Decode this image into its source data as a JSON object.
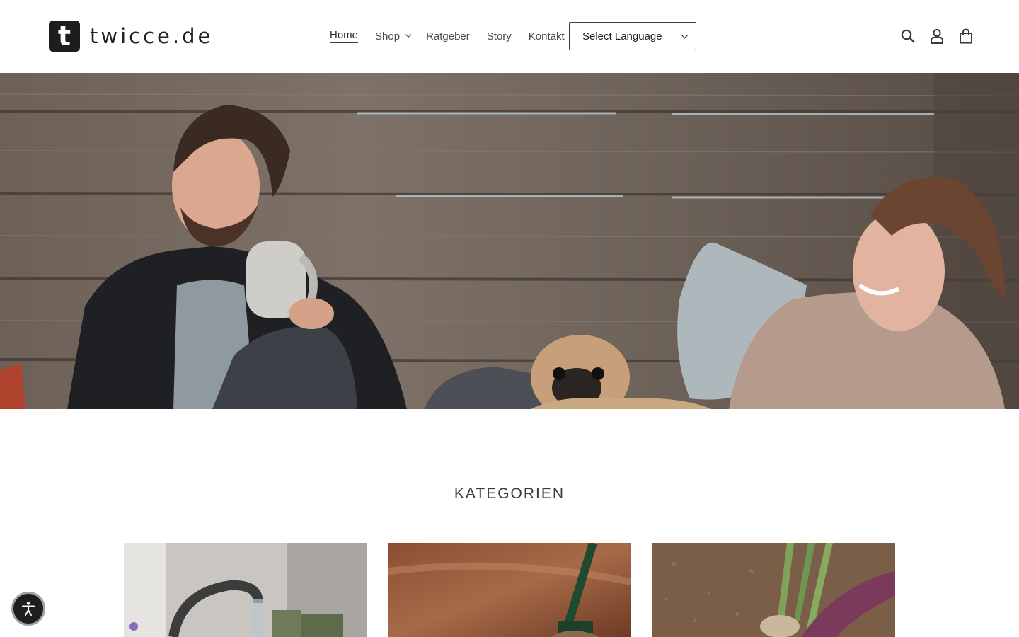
{
  "header": {
    "logo_letter": "t",
    "logo_text": "twicce.de",
    "nav": [
      {
        "label": "Home",
        "active": true
      },
      {
        "label": "Shop",
        "has_dropdown": true
      },
      {
        "label": "Ratgeber"
      },
      {
        "label": "Story"
      },
      {
        "label": "Kontakt"
      }
    ],
    "language_select": {
      "value": "Select Language"
    },
    "icons": [
      "search-icon",
      "account-icon",
      "cart-icon"
    ]
  },
  "hero": {
    "image_alt": "Man with mug, pug and smiling woman in scarf sitting by a wooden fence"
  },
  "categories": {
    "title": "KATEGORIEN",
    "cards": [
      {
        "image_alt": "Faucet with running water and flowers"
      },
      {
        "image_alt": "Green garden tool on brown wood background"
      },
      {
        "image_alt": "Hands planting in garden soil"
      }
    ]
  },
  "accessibility": {
    "icon": "accessibility-icon"
  },
  "colors": {
    "text": "#3a3a3a",
    "brand_dark": "#1d1d1d",
    "background": "#ffffff"
  }
}
